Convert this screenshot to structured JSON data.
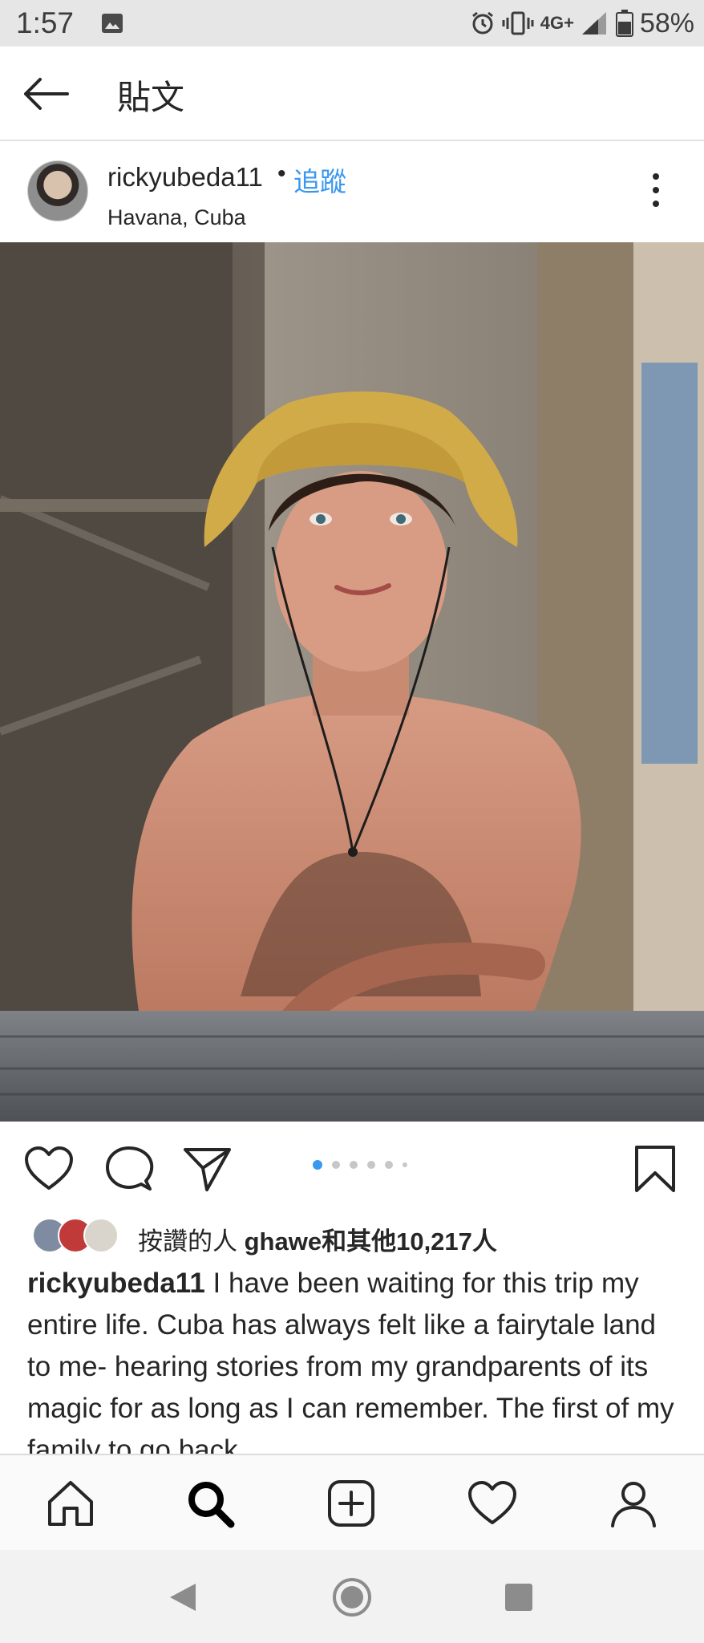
{
  "status_bar": {
    "time": "1:57",
    "network": "4G+",
    "battery": "58%",
    "icons": [
      "image-icon",
      "alarm-icon",
      "vibrate-icon",
      "signal-icon",
      "battery-icon"
    ]
  },
  "header": {
    "title": "貼文",
    "back_icon": "arrow-left-icon"
  },
  "post": {
    "username": "rickyubeda11",
    "dot": "•",
    "follow": "追蹤",
    "location": "Havana, Cuba",
    "more_icon": "more-vertical-icon"
  },
  "actions": {
    "icons": [
      "heart-icon",
      "comment-icon",
      "share-icon",
      "bookmark-icon"
    ],
    "carousel": {
      "total": 6,
      "active_index": 0
    }
  },
  "likes": {
    "prefix": "按讚的人 ",
    "highlight": "ghawe和其他10,217人"
  },
  "caption": {
    "username": "rickyubeda11",
    "text": " I have been waiting for this trip my entire life. Cuba has always felt like a fairytale land to me- hearing stories from my grandparents of its magic for as long as I can remember. The first of my family to go back"
  },
  "bottom_nav": {
    "items": [
      "home-icon",
      "search-icon",
      "add-post-icon",
      "activity-heart-icon",
      "profile-icon"
    ],
    "active": "search-icon"
  },
  "system_nav": [
    "back-triangle-icon",
    "home-circle-icon",
    "recents-square-icon"
  ],
  "colors": {
    "link": "#3897f0",
    "text": "#262626",
    "status_bar_bg": "#e6e6e6"
  }
}
